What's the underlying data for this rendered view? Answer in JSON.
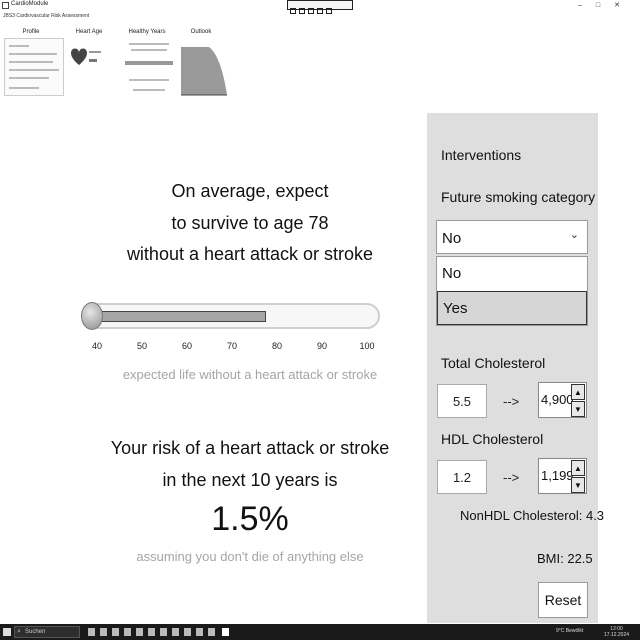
{
  "window": {
    "title": "CardioModule",
    "subtitle": "JBS3 Cardiovascular Risk Assessment"
  },
  "nav": {
    "tabs": [
      "Profile",
      "Heart Age",
      "Healthy Years",
      "Outlook"
    ]
  },
  "main": {
    "expect_lines": [
      "On average, expect",
      "to survive to age 78",
      "without a heart attack or stroke"
    ],
    "gauge": {
      "ticks": [
        "40",
        "50",
        "60",
        "70",
        "80",
        "90",
        "100"
      ],
      "value": 78,
      "min": 40,
      "max": 100
    },
    "gauge_caption": "expected life without a heart attack or stroke",
    "risk_lines": [
      "Your risk of a heart attack or stroke",
      "in the next 10 years is"
    ],
    "risk_value": "1.5%",
    "risk_caption": "assuming you don't die of anything else"
  },
  "panel": {
    "title": "Interventions",
    "smoking_label": "Future smoking category",
    "smoking_value": "No",
    "smoking_options": [
      "No",
      "Yes"
    ],
    "smoking_selected_option": "Yes",
    "total_chol_label": "Total Cholesterol",
    "total_chol_current": "5.5",
    "total_chol_target": "4,900",
    "hdl_label": "HDL Cholesterol",
    "hdl_current": "1.2",
    "hdl_target": "1,199",
    "arrow": "-->",
    "nonhdl": "NonHDL Cholesterol: 4.3",
    "bmi": "BMI: 22.5",
    "reset_label": "Reset"
  },
  "taskbar": {
    "search_placeholder": "Suchen",
    "tray_text": "9°C  Bewölkt",
    "time": "13:00",
    "date": "17.12.2024"
  }
}
